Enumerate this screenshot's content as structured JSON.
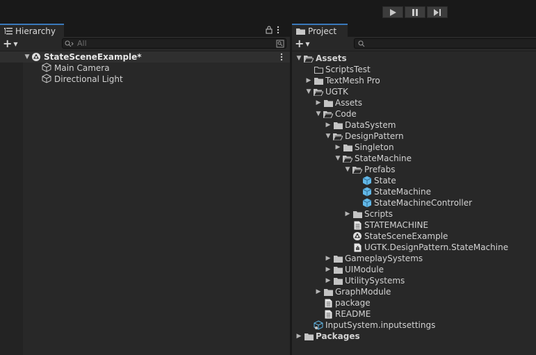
{
  "hierarchy": {
    "tab_label": "Hierarchy",
    "search_placeholder": "All",
    "scene_name": "StateSceneExample*",
    "objects": [
      "Main Camera",
      "Directional Light"
    ]
  },
  "project": {
    "tab_label": "Project",
    "search_placeholder": "",
    "tree": [
      {
        "label": "Assets",
        "depth": 0,
        "arrow": "open",
        "icon": "folder-open",
        "bold": true
      },
      {
        "label": "ScriptsTest",
        "depth": 1,
        "arrow": "none",
        "icon": "folder-outline",
        "bold": false
      },
      {
        "label": "TextMesh Pro",
        "depth": 1,
        "arrow": "closed",
        "icon": "folder",
        "bold": false
      },
      {
        "label": "UGTK",
        "depth": 1,
        "arrow": "open",
        "icon": "folder-open",
        "bold": false
      },
      {
        "label": "Assets",
        "depth": 2,
        "arrow": "closed",
        "icon": "folder",
        "bold": false
      },
      {
        "label": "Code",
        "depth": 2,
        "arrow": "open",
        "icon": "folder-open",
        "bold": false
      },
      {
        "label": "DataSystem",
        "depth": 3,
        "arrow": "closed",
        "icon": "folder",
        "bold": false
      },
      {
        "label": "DesignPattern",
        "depth": 3,
        "arrow": "open",
        "icon": "folder-open",
        "bold": false
      },
      {
        "label": "Singleton",
        "depth": 4,
        "arrow": "closed",
        "icon": "folder",
        "bold": false
      },
      {
        "label": "StateMachine",
        "depth": 4,
        "arrow": "open",
        "icon": "folder-open",
        "bold": false
      },
      {
        "label": "Prefabs",
        "depth": 5,
        "arrow": "open",
        "icon": "folder-open",
        "bold": false
      },
      {
        "label": "State",
        "depth": 6,
        "arrow": "none",
        "icon": "prefab",
        "bold": false
      },
      {
        "label": "StateMachine",
        "depth": 6,
        "arrow": "none",
        "icon": "prefab",
        "bold": false
      },
      {
        "label": "StateMachineController",
        "depth": 6,
        "arrow": "none",
        "icon": "prefab",
        "bold": false
      },
      {
        "label": "Scripts",
        "depth": 5,
        "arrow": "closed",
        "icon": "folder",
        "bold": false
      },
      {
        "label": "STATEMACHINE",
        "depth": 5,
        "arrow": "none",
        "icon": "text-file",
        "bold": false
      },
      {
        "label": "StateSceneExample",
        "depth": 5,
        "arrow": "none",
        "icon": "unity-scene",
        "bold": false
      },
      {
        "label": "UGTK.DesignPattern.StateMachine",
        "depth": 5,
        "arrow": "none",
        "icon": "asmdef",
        "bold": false
      },
      {
        "label": "GameplaySystems",
        "depth": 3,
        "arrow": "closed",
        "icon": "folder",
        "bold": false
      },
      {
        "label": "UIModule",
        "depth": 3,
        "arrow": "closed",
        "icon": "folder",
        "bold": false
      },
      {
        "label": "UtilitySystems",
        "depth": 3,
        "arrow": "closed",
        "icon": "folder",
        "bold": false
      },
      {
        "label": "GraphModule",
        "depth": 2,
        "arrow": "closed",
        "icon": "folder",
        "bold": false
      },
      {
        "label": "package",
        "depth": 2,
        "arrow": "none",
        "icon": "text-file",
        "bold": false
      },
      {
        "label": "README",
        "depth": 2,
        "arrow": "none",
        "icon": "text-file",
        "bold": false
      },
      {
        "label": "InputSystem.inputsettings",
        "depth": 1,
        "arrow": "none",
        "icon": "settings-asset",
        "bold": false
      },
      {
        "label": "Packages",
        "depth": 0,
        "arrow": "closed",
        "icon": "folder",
        "bold": true
      }
    ]
  },
  "colors": {
    "accent": "#3a79bb",
    "prefab": "#62b8e8",
    "panel": "#282828"
  }
}
